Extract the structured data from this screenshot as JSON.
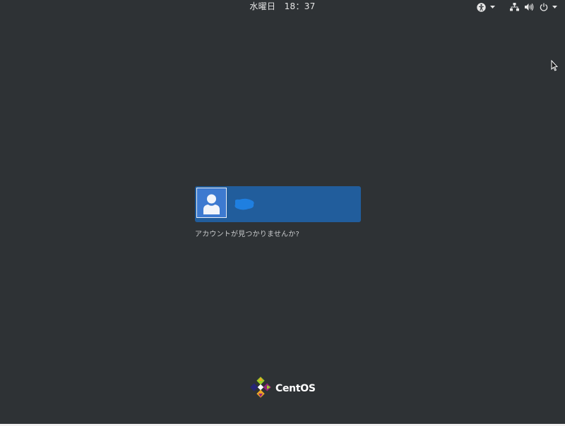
{
  "topbar": {
    "clock": "水曜日　18：37",
    "icons": {
      "accessibility": "accessibility-icon",
      "network": "network-wired-icon",
      "volume": "volume-icon",
      "power": "power-icon"
    }
  },
  "login": {
    "username": "",
    "avatar_icon": "user-avatar-icon",
    "not_listed": "アカウントが見つかりませんか?"
  },
  "brand": {
    "name": "CentOS"
  },
  "colors": {
    "background": "#2e3235",
    "selected_user": "#215d9c",
    "avatar_bg": "#3d7ad0",
    "redaction": "#1f7fe0"
  }
}
